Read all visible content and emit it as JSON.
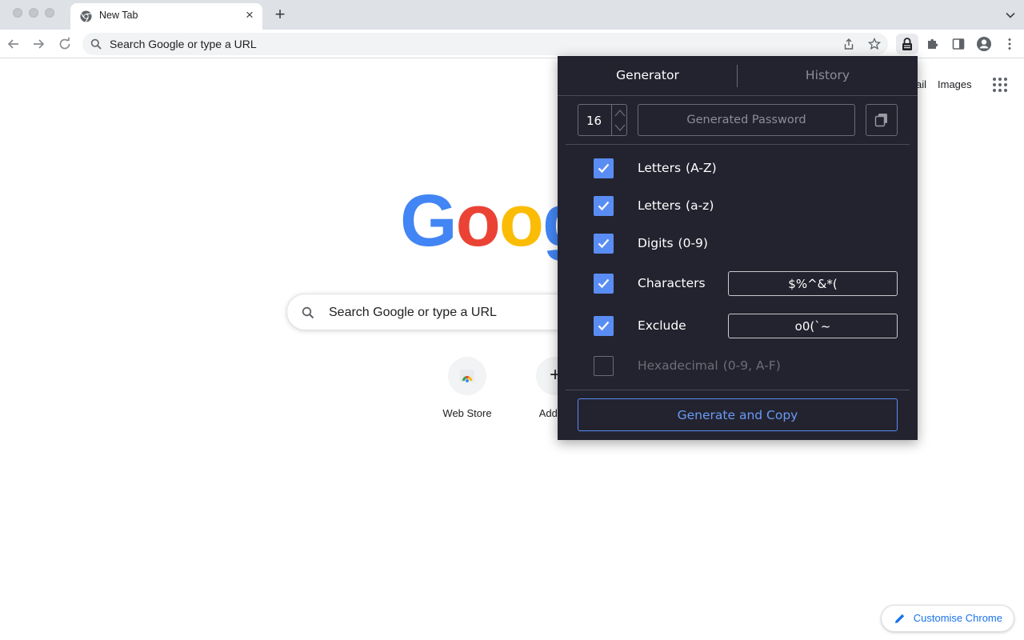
{
  "tab": {
    "title": "New Tab"
  },
  "omnibox": {
    "text": "Search Google or type a URL"
  },
  "ntp": {
    "links": [
      "ail",
      "Images"
    ],
    "logo_letters": [
      "G",
      "o",
      "o",
      "g"
    ],
    "search_placeholder": "Search Google or type a URL",
    "shortcuts": [
      {
        "label": "Web Store"
      },
      {
        "label": "Add sh"
      }
    ],
    "customise_label": "Customise Chrome"
  },
  "popup": {
    "tabs": {
      "generator": "Generator",
      "history": "History"
    },
    "length": "16",
    "password_placeholder": "Generated Password",
    "options": [
      {
        "label": "Letters",
        "range": "(A-Z)",
        "checked": true
      },
      {
        "label": "Letters",
        "range": "(a-z)",
        "checked": true
      },
      {
        "label": "Digits",
        "range": "(0-9)",
        "checked": true
      },
      {
        "label": "Characters",
        "range": "",
        "checked": true,
        "value": "$%^&*("
      },
      {
        "label": "Exclude",
        "range": "",
        "checked": true,
        "value": "o0(`~"
      },
      {
        "label": "Hexadecimal",
        "range": "(0-9, A-F)",
        "checked": false
      }
    ],
    "generate_button": "Generate and Copy"
  },
  "colors": {
    "popup_bg": "#23232f",
    "accent": "#5a8df3",
    "google_blue": "#4285f4",
    "google_red": "#ea4335",
    "google_yellow": "#fbbc05"
  }
}
